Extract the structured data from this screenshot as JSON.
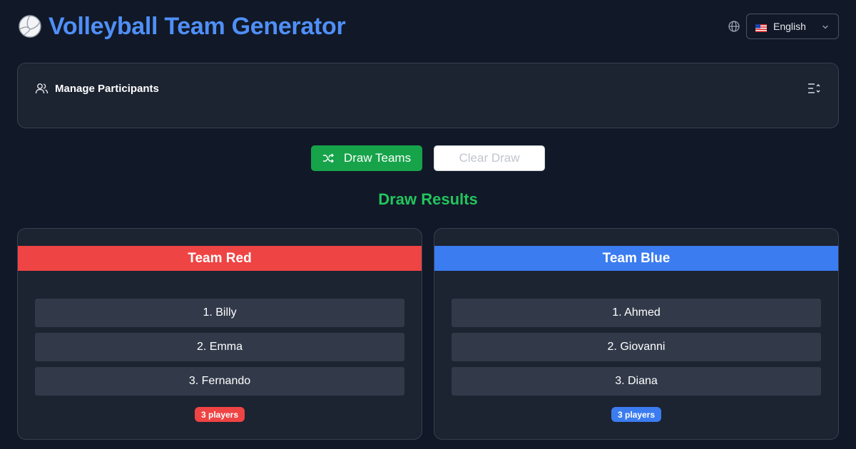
{
  "header": {
    "title": "Volleyball Team Generator",
    "title_icon": "volleyball-icon",
    "language": {
      "icon": "globe-icon",
      "flag": "us-flag-icon",
      "selected": "English"
    }
  },
  "participants_panel": {
    "title": "Manage Participants",
    "icon": "users-icon",
    "toggle_icon": "list-sort-icon"
  },
  "actions": {
    "draw_label": "Draw Teams",
    "draw_icon": "shuffle-icon",
    "clear_label": "Clear Draw"
  },
  "results": {
    "title": "Draw Results",
    "teams": [
      {
        "name": "Team Red",
        "color": "#ef4444",
        "players": [
          "1. Billy",
          "2. Emma",
          "3. Fernando"
        ],
        "count_label": "3 players"
      },
      {
        "name": "Team Blue",
        "color": "#3b7cf0",
        "players": [
          "1. Ahmed",
          "2. Giovanni",
          "3. Diana"
        ],
        "count_label": "3 players"
      }
    ]
  },
  "colors": {
    "background": "#111827",
    "title_blue": "#4f8ff7",
    "draw_button": "#16a34a",
    "results_green": "#22c55e"
  }
}
